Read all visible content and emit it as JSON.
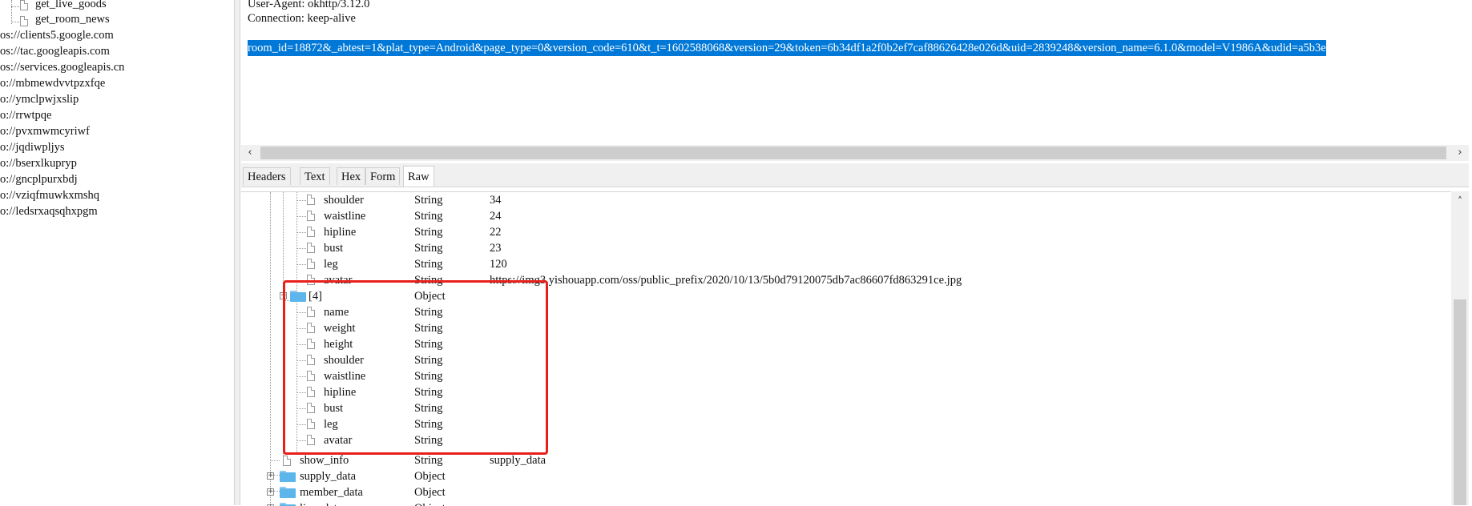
{
  "left_tree": {
    "child_items": [
      "get_live_goods",
      "get_room_news"
    ],
    "hosts": [
      "os://clients5.google.com",
      "os://tac.googleapis.com",
      "os://services.googleapis.cn",
      "o://mbmewdvvtpzxfqe",
      "o://ymclpwjxslip",
      "o://rrwtpqe",
      "o://pvxmwmcyriwf",
      "o://jqdiwpljys",
      "o://bserxlkupryp",
      "o://gncplpurxbdj",
      "o://vziqfmuwkxmshq",
      "o://ledsrxaqsqhxpgm"
    ]
  },
  "raw_request": {
    "lines": [
      "User-Agent: okhttp/3.12.0",
      "Connection: keep-alive"
    ],
    "body": "room_id=18872&_abtest=1&plat_type=Android&page_type=0&version_code=610&t_t=1602588068&version=29&token=6b34df1a2f0b2ef7caf88626428e026d&uid=2839248&version_name=6.1.0&model=V1986A&udid=a5b3e"
  },
  "tabs": [
    {
      "label": "Headers",
      "active": false
    },
    {
      "label": "Text",
      "active": false
    },
    {
      "label": "Hex",
      "active": false
    },
    {
      "label": "Form",
      "active": false
    },
    {
      "label": "Raw",
      "active": true
    }
  ],
  "json_tree": {
    "rows": [
      {
        "name": "shoulder",
        "type": "String",
        "value": "34",
        "kind": "leaf"
      },
      {
        "name": "waistline",
        "type": "String",
        "value": "24",
        "kind": "leaf"
      },
      {
        "name": "hipline",
        "type": "String",
        "value": "22",
        "kind": "leaf"
      },
      {
        "name": "bust",
        "type": "String",
        "value": "23",
        "kind": "leaf"
      },
      {
        "name": "leg",
        "type": "String",
        "value": "120",
        "kind": "leaf"
      },
      {
        "name": "avatar",
        "type": "String",
        "value": "https://img3.yishouapp.com/oss/public_prefix/2020/10/13/5b0d79120075db7ac86607fd863291ce.jpg",
        "kind": "leaf"
      },
      {
        "name": "[4]",
        "type": "Object",
        "value": "",
        "kind": "folder-open"
      },
      {
        "name": "name",
        "type": "String",
        "value": "",
        "kind": "leaf"
      },
      {
        "name": "weight",
        "type": "String",
        "value": "",
        "kind": "leaf"
      },
      {
        "name": "height",
        "type": "String",
        "value": "",
        "kind": "leaf"
      },
      {
        "name": "shoulder",
        "type": "String",
        "value": "",
        "kind": "leaf"
      },
      {
        "name": "waistline",
        "type": "String",
        "value": "",
        "kind": "leaf"
      },
      {
        "name": "hipline",
        "type": "String",
        "value": "",
        "kind": "leaf"
      },
      {
        "name": "bust",
        "type": "String",
        "value": "",
        "kind": "leaf"
      },
      {
        "name": "leg",
        "type": "String",
        "value": "",
        "kind": "leaf"
      },
      {
        "name": "avatar",
        "type": "String",
        "value": "",
        "kind": "leaf"
      },
      {
        "name": "show_info",
        "type": "String",
        "value": "supply_data",
        "kind": "leaf-top"
      },
      {
        "name": "supply_data",
        "type": "Object",
        "value": "",
        "kind": "folder-closed"
      },
      {
        "name": "member_data",
        "type": "Object",
        "value": "",
        "kind": "folder-closed"
      },
      {
        "name": "live_data",
        "type": "Object",
        "value": "",
        "kind": "folder-closed"
      }
    ]
  },
  "colors": {
    "selection": "#0078d7",
    "highlight_box": "#e8201c",
    "folder": "#5cb6ec"
  }
}
